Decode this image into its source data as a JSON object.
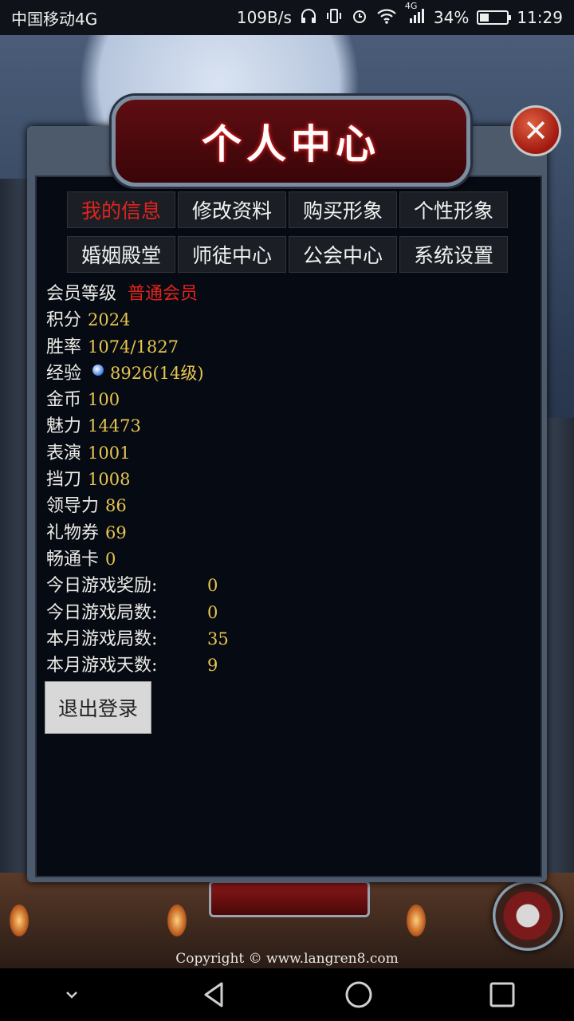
{
  "status_bar": {
    "carrier": "中国移动4G",
    "speed": "109B/s",
    "network": "4G",
    "battery": "34%",
    "battery_level": 0.34,
    "time": "11:29"
  },
  "panel": {
    "title": "个人中心",
    "close_glyph": "✕"
  },
  "tabs": [
    {
      "label": "我的信息",
      "active": true
    },
    {
      "label": "修改资料",
      "active": false
    },
    {
      "label": "购买形象",
      "active": false
    },
    {
      "label": "个性形象",
      "active": false
    },
    {
      "label": "婚姻殿堂",
      "active": false
    },
    {
      "label": "师徒中心",
      "active": false
    },
    {
      "label": "公会中心",
      "active": false
    },
    {
      "label": "系统设置",
      "active": false
    }
  ],
  "info": {
    "member_level": {
      "label": "会员等级",
      "value": "普通会员"
    },
    "points": {
      "label": "积分",
      "value": "2024"
    },
    "win_rate": {
      "label": "胜率",
      "value": "1074/1827"
    },
    "experience": {
      "label": "经验",
      "value": "8926(14级)",
      "icon": "exp-gem-icon"
    },
    "gold": {
      "label": "金币",
      "value": "100"
    },
    "charm": {
      "label": "魅力",
      "value": "14473"
    },
    "performance": {
      "label": "表演",
      "value": "1001"
    },
    "block": {
      "label": "挡刀",
      "value": "1008"
    },
    "leadership": {
      "label": "领导力",
      "value": "86"
    },
    "gift_vouchers": {
      "label": "礼物券",
      "value": "69"
    },
    "pass_card": {
      "label": "畅通卡",
      "value": "0"
    },
    "today_reward": {
      "label": "今日游戏奖励:",
      "value": "0"
    },
    "today_games": {
      "label": "今日游戏局数:",
      "value": "0"
    },
    "month_games": {
      "label": "本月游戏局数:",
      "value": "35"
    },
    "month_days": {
      "label": "本月游戏天数:",
      "value": "9"
    }
  },
  "logout_label": "退出登录",
  "footer": {
    "copyright": "Copyright © www.langren8.com"
  },
  "colors": {
    "active_tab": "#e0241c",
    "value_gold": "#e6c550",
    "member_red": "#e0241c"
  }
}
